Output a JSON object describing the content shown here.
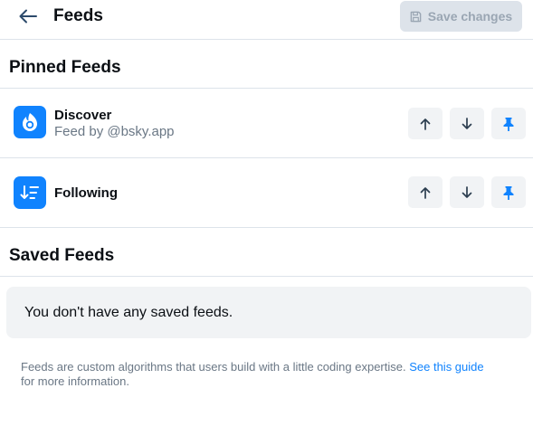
{
  "header": {
    "title": "Feeds",
    "save_label": "Save changes",
    "back_icon": "arrow-left-icon"
  },
  "pinned": {
    "title": "Pinned Feeds",
    "feeds": [
      {
        "name": "Discover",
        "creator": "Feed by @bsky.app",
        "icon": "discover-feed-icon",
        "pinned": true
      },
      {
        "name": "Following",
        "icon": "following-feed-icon",
        "pinned": true
      }
    ]
  },
  "saved": {
    "title": "Saved Feeds",
    "empty_text": "You don't have any saved feeds."
  },
  "footer": {
    "text": "Feeds are custom algorithms that users build with a little coding expertise.",
    "link_text": "See this guide",
    "text_after": "for more information."
  },
  "colors": {
    "accent": "#1083fe",
    "muted_text": "#6a7785",
    "button_bg": "#f1f3f5",
    "disabled_button_bg": "#dde3ea",
    "divider": "#dde3ea"
  }
}
